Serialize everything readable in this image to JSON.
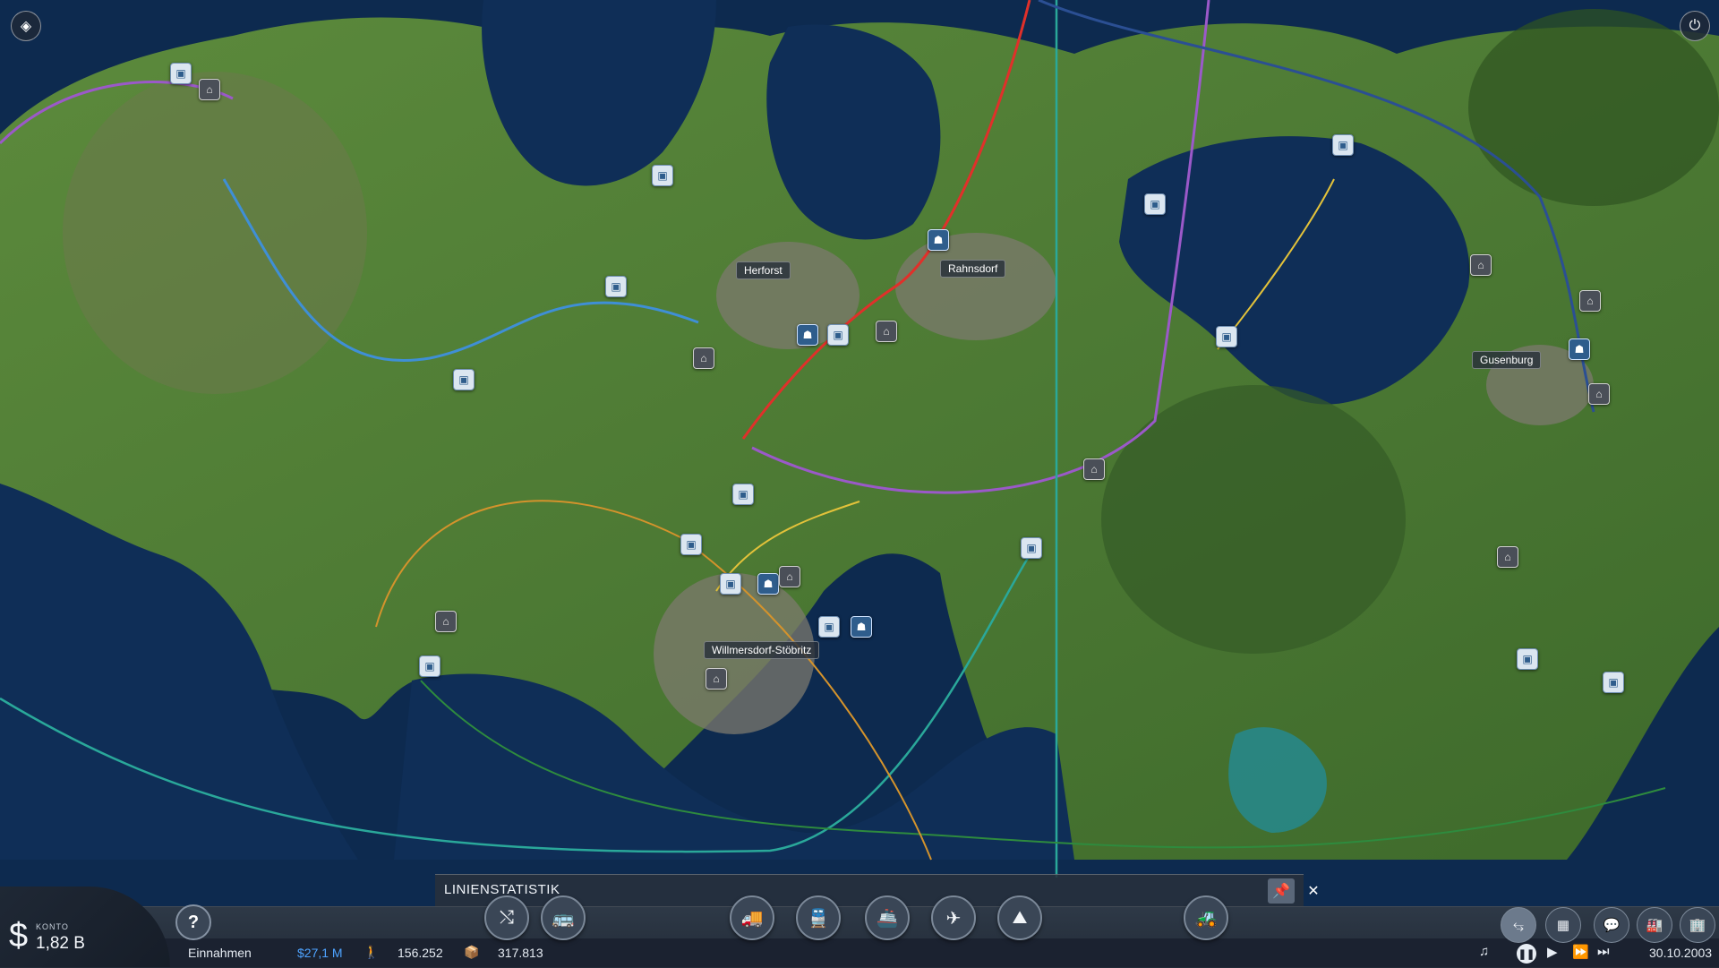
{
  "map": {
    "cities": [
      {
        "name": "Herforst"
      },
      {
        "name": "Rahnsdorf"
      },
      {
        "name": "Gusenburg"
      },
      {
        "name": "Willmersdorf-Stöbritz"
      }
    ]
  },
  "corner_buttons": {
    "layers_icon": "layers-icon",
    "power_icon": "power-icon"
  },
  "stats_panel": {
    "title": "LINIENSTATISTIK"
  },
  "toolbar": {
    "left_buttons": [
      "lines-manager-icon",
      "vehicle-manager-icon"
    ],
    "center_buttons": [
      "road-vehicle-icon",
      "train-icon",
      "ship-icon",
      "plane-icon",
      "terrain-icon"
    ],
    "bulldozer": "bulldozer-icon",
    "right_buttons": [
      "route-filter-icon",
      "depot-icon",
      "speech-bubble-icon",
      "industry-icon",
      "building-icon"
    ]
  },
  "account": {
    "label": "KONTO",
    "value": "1,82 B",
    "symbol": "$"
  },
  "info": {
    "income_label": "Einnahmen",
    "income_value": "$27,1 M",
    "passengers": "156.252",
    "cargo": "317.813",
    "date": "30.10.2003"
  },
  "colors": {
    "water": "#0d2a4f",
    "land": "#4f7d36",
    "accent_blue": "#4ea3ff"
  }
}
